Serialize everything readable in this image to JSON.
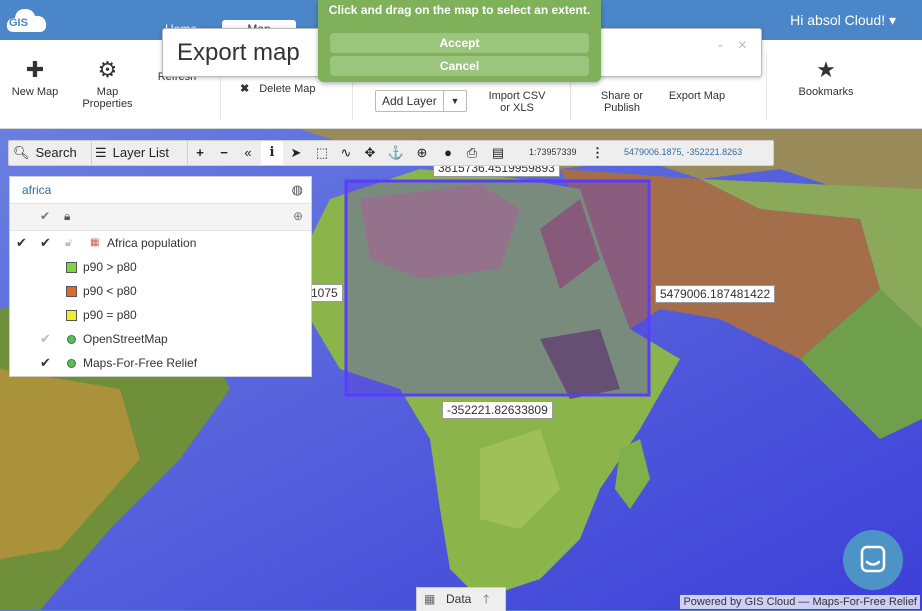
{
  "app": {
    "logo_text": "GIS",
    "user_menu": "Hi absol Cloud! ▾"
  },
  "nav": {
    "home": "Home",
    "map": "Map"
  },
  "toolbar": {
    "new_map": "New Map",
    "map_properties": "Map Properties",
    "refresh": "Refresh",
    "delete_map": "Delete Map",
    "add_layer": "Add Layer",
    "import_csv": "Import CSV or XLS",
    "share_publish": "Share or Publish",
    "export_map": "Export Map",
    "bookmarks": "Bookmarks"
  },
  "export_dialog": {
    "title": "Export map",
    "minimize": "-",
    "close": "×",
    "instruction": "Click and drag on the map to select an extent.",
    "accept": "Accept",
    "cancel": "Cancel"
  },
  "map_toolbar": {
    "search": "Search",
    "layer_list": "Layer List",
    "scale": "1:73957339",
    "coordinates": "5479006.1875, -352221.8263"
  },
  "layer_panel": {
    "search_value": "africa",
    "layers": [
      {
        "name": "Africa population",
        "checked": true
      },
      {
        "legend": "p90 > p80",
        "color": "#7dd63f"
      },
      {
        "legend": "p90 < p80",
        "color": "#e06a2a"
      },
      {
        "legend": "p90 = p80",
        "color": "#f0f02a"
      },
      {
        "name": "OpenStreetMap",
        "checked": false
      },
      {
        "name": "Maps-For-Free Relief",
        "checked": true
      }
    ]
  },
  "extent_labels": {
    "top": "3815736.4519959893",
    "left": "1075",
    "right": "5479006.187481422",
    "bottom": "-352221.82633809"
  },
  "data_tab": "Data",
  "attribution": "Powered by GIS Cloud — Maps-For-Free Relief"
}
